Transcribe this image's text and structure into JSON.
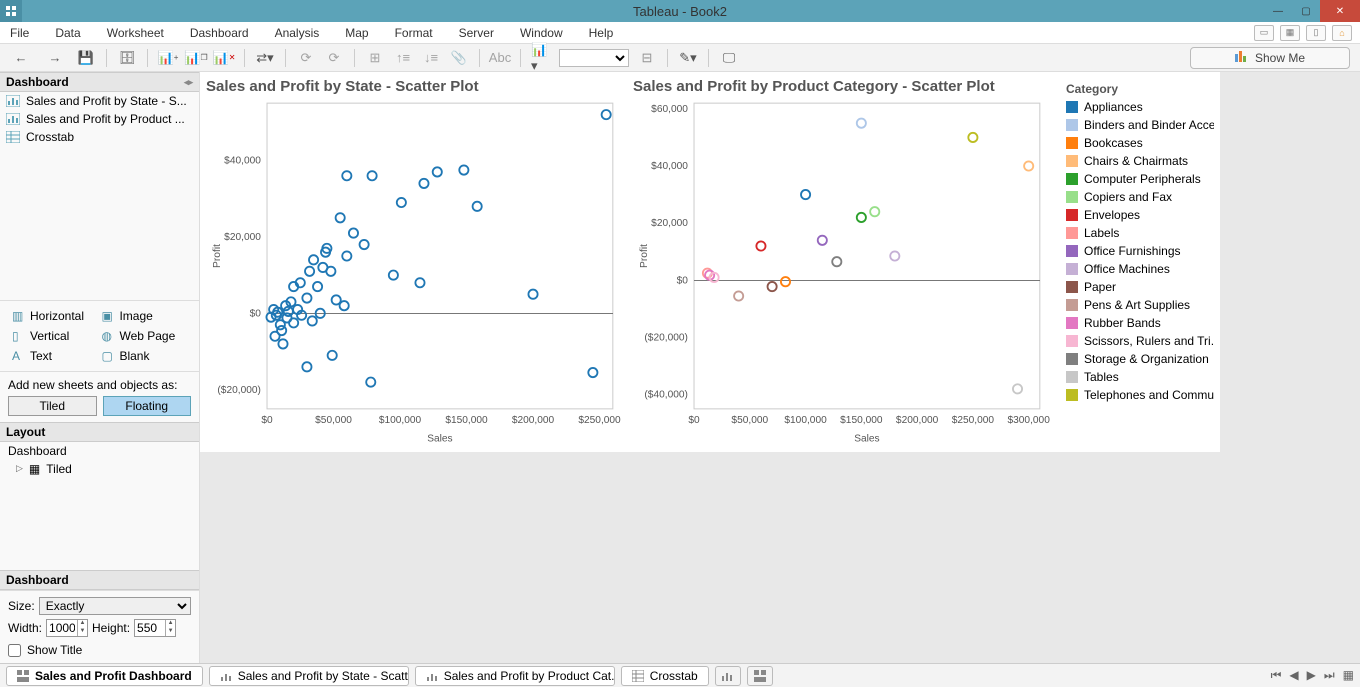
{
  "titlebar": {
    "title": "Tableau - Book2"
  },
  "menubar": {
    "items": [
      "File",
      "Data",
      "Worksheet",
      "Dashboard",
      "Analysis",
      "Map",
      "Format",
      "Server",
      "Window",
      "Help"
    ]
  },
  "showme": {
    "label": "Show Me"
  },
  "side": {
    "dashboard_header": "Dashboard",
    "sheets": [
      {
        "label": "Sales and Profit by State - S...",
        "type": "sheet"
      },
      {
        "label": "Sales and Profit by Product ...",
        "type": "sheet"
      },
      {
        "label": "Crosstab",
        "type": "crosstab"
      }
    ],
    "objects": {
      "rows": [
        [
          {
            "icon": "▥",
            "label": "Horizontal"
          },
          {
            "icon": "▣",
            "label": "Image"
          }
        ],
        [
          {
            "icon": "▯",
            "label": "Vertical"
          },
          {
            "icon": "◍",
            "label": "Web Page"
          }
        ],
        [
          {
            "icon": "A",
            "label": "Text"
          },
          {
            "icon": "▢",
            "label": "Blank"
          }
        ]
      ]
    },
    "addnew": {
      "label": "Add new sheets and objects as:",
      "tiled": "Tiled",
      "floating": "Floating",
      "active": "Floating"
    },
    "layout": {
      "header": "Layout",
      "root": "Dashboard",
      "child": "Tiled"
    },
    "dashprops": {
      "header": "Dashboard",
      "size_label": "Size:",
      "size_value": "Exactly",
      "width_label": "Width:",
      "width_value": "1000",
      "height_label": "Height:",
      "height_value": "550",
      "show_title": "Show Title",
      "show_title_checked": false
    }
  },
  "legend": {
    "header": "Category",
    "items": [
      {
        "label": "Appliances",
        "color": "#1f77b4"
      },
      {
        "label": "Binders and Binder Acce..",
        "color": "#aec7e8"
      },
      {
        "label": "Bookcases",
        "color": "#ff7f0e"
      },
      {
        "label": "Chairs & Chairmats",
        "color": "#ffbb78"
      },
      {
        "label": "Computer Peripherals",
        "color": "#2ca02c"
      },
      {
        "label": "Copiers and Fax",
        "color": "#98df8a"
      },
      {
        "label": "Envelopes",
        "color": "#d62728"
      },
      {
        "label": "Labels",
        "color": "#ff9896"
      },
      {
        "label": "Office Furnishings",
        "color": "#9467bd"
      },
      {
        "label": "Office Machines",
        "color": "#c5b0d5"
      },
      {
        "label": "Paper",
        "color": "#8c564b"
      },
      {
        "label": "Pens & Art Supplies",
        "color": "#c49c94"
      },
      {
        "label": "Rubber Bands",
        "color": "#e377c2"
      },
      {
        "label": "Scissors, Rulers and Tri..",
        "color": "#f7b6d2"
      },
      {
        "label": "Storage & Organization",
        "color": "#7f7f7f"
      },
      {
        "label": "Tables",
        "color": "#c7c7c7"
      },
      {
        "label": "Telephones and Commu..",
        "color": "#bcbd22"
      }
    ]
  },
  "bottombar": {
    "tabs": [
      {
        "label": "Sales and Profit Dashboard",
        "type": "dash",
        "active": true
      },
      {
        "label": "Sales and Profit by State - Scatt...",
        "type": "sheet"
      },
      {
        "label": "Sales and Profit by Product Cat...",
        "type": "sheet"
      },
      {
        "label": "Crosstab",
        "type": "crosstab"
      }
    ]
  },
  "chart_data": [
    {
      "type": "scatter",
      "title": "Sales and Profit by State - Scatter Plot",
      "xlabel": "Sales",
      "ylabel": "Profit",
      "xlim": [
        0,
        260000
      ],
      "ylim": [
        -25000,
        55000
      ],
      "xticks": [
        0,
        50000,
        100000,
        150000,
        200000,
        250000
      ],
      "xticklabels": [
        "$0",
        "$50,000",
        "$100,000",
        "$150,000",
        "$200,000",
        "$250,000"
      ],
      "yticks": [
        -20000,
        0,
        20000,
        40000
      ],
      "yticklabels": [
        "($20,000)",
        "$0",
        "$20,000",
        "$40,000"
      ],
      "color": "#1f77b4",
      "points": [
        [
          3000,
          -1000
        ],
        [
          5000,
          1000
        ],
        [
          6000,
          -6000
        ],
        [
          7000,
          -500
        ],
        [
          8000,
          300
        ],
        [
          10000,
          -3000
        ],
        [
          11000,
          -4500
        ],
        [
          12000,
          -8000
        ],
        [
          14000,
          2000
        ],
        [
          15000,
          -1200
        ],
        [
          16000,
          500
        ],
        [
          18000,
          3000
        ],
        [
          20000,
          -2500
        ],
        [
          20000,
          7000
        ],
        [
          23000,
          1000
        ],
        [
          25000,
          8000
        ],
        [
          26000,
          -500
        ],
        [
          30000,
          -14000
        ],
        [
          30000,
          4000
        ],
        [
          32000,
          11000
        ],
        [
          34000,
          -2000
        ],
        [
          35000,
          14000
        ],
        [
          38000,
          7000
        ],
        [
          40000,
          0
        ],
        [
          42000,
          12000
        ],
        [
          44000,
          16000
        ],
        [
          45000,
          17000
        ],
        [
          48000,
          11000
        ],
        [
          49000,
          -11000
        ],
        [
          52000,
          3500
        ],
        [
          55000,
          25000
        ],
        [
          58000,
          2000
        ],
        [
          60000,
          15000
        ],
        [
          60000,
          36000
        ],
        [
          65000,
          21000
        ],
        [
          73000,
          18000
        ],
        [
          78000,
          -18000
        ],
        [
          79000,
          36000
        ],
        [
          95000,
          10000
        ],
        [
          101000,
          29000
        ],
        [
          115000,
          8000
        ],
        [
          118000,
          34000
        ],
        [
          128000,
          37000
        ],
        [
          148000,
          37500
        ],
        [
          158000,
          28000
        ],
        [
          200000,
          5000
        ],
        [
          245000,
          -15500
        ],
        [
          255000,
          52000
        ]
      ]
    },
    {
      "type": "scatter",
      "title": "Sales and Profit by Product Category - Scatter Plot",
      "xlabel": "Sales",
      "ylabel": "Profit",
      "xlim": [
        0,
        310000
      ],
      "ylim": [
        -45000,
        62000
      ],
      "xticks": [
        0,
        50000,
        100000,
        150000,
        200000,
        250000,
        300000
      ],
      "xticklabels": [
        "$0",
        "$50,000",
        "$100,000",
        "$150,000",
        "$200,000",
        "$250,000",
        "$300,000"
      ],
      "yticks": [
        -40000,
        -20000,
        0,
        20000,
        40000,
        60000
      ],
      "yticklabels": [
        "($40,000)",
        "($20,000)",
        "$0",
        "$20,000",
        "$40,000",
        "$60,000"
      ],
      "points_categorical": [
        {
          "category": "Appliances",
          "x": 100000,
          "y": 30000,
          "color": "#1f77b4"
        },
        {
          "category": "Binders and Binder Acce..",
          "x": 150000,
          "y": 55000,
          "color": "#aec7e8"
        },
        {
          "category": "Bookcases",
          "x": 82000,
          "y": -500,
          "color": "#ff7f0e"
        },
        {
          "category": "Chairs & Chairmats",
          "x": 300000,
          "y": 40000,
          "color": "#ffbb78"
        },
        {
          "category": "Computer Peripherals",
          "x": 150000,
          "y": 22000,
          "color": "#2ca02c"
        },
        {
          "category": "Copiers and Fax",
          "x": 162000,
          "y": 24000,
          "color": "#98df8a"
        },
        {
          "category": "Envelopes",
          "x": 60000,
          "y": 12000,
          "color": "#d62728"
        },
        {
          "category": "Labels",
          "x": 12000,
          "y": 2500,
          "color": "#ff9896"
        },
        {
          "category": "Office Furnishings",
          "x": 115000,
          "y": 14000,
          "color": "#9467bd"
        },
        {
          "category": "Office Machines",
          "x": 180000,
          "y": 8500,
          "color": "#c5b0d5"
        },
        {
          "category": "Paper",
          "x": 70000,
          "y": -2200,
          "color": "#8c564b"
        },
        {
          "category": "Pens & Art Supplies",
          "x": 40000,
          "y": -5500,
          "color": "#c49c94"
        },
        {
          "category": "Rubber Bands",
          "x": 14000,
          "y": 1800,
          "color": "#e377c2"
        },
        {
          "category": "Scissors, Rulers and Tri..",
          "x": 18000,
          "y": 1000,
          "color": "#f7b6d2"
        },
        {
          "category": "Storage & Organization",
          "x": 128000,
          "y": 6500,
          "color": "#7f7f7f"
        },
        {
          "category": "Tables",
          "x": 290000,
          "y": -38000,
          "color": "#c7c7c7"
        },
        {
          "category": "Telephones and Commu..",
          "x": 250000,
          "y": 50000,
          "color": "#bcbd22"
        }
      ]
    }
  ]
}
